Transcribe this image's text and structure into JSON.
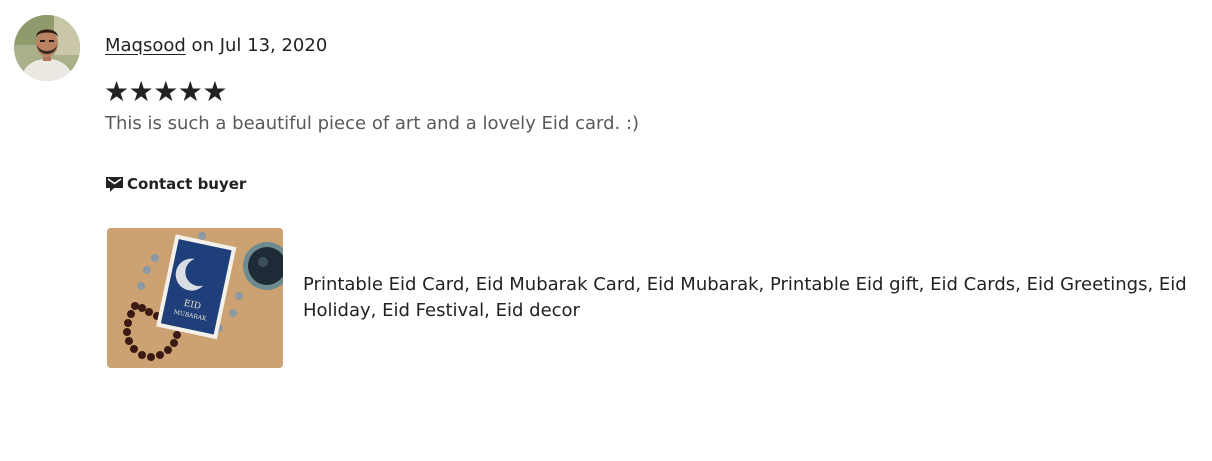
{
  "review": {
    "reviewer_name": "Maqsood",
    "date_text": " on Jul 13, 2020",
    "rating": 5,
    "stars": [
      "★",
      "★",
      "★",
      "★",
      "★"
    ],
    "text": "This is such a beautiful piece of art and a lovely Eid card. :)",
    "contact_label": "Contact buyer",
    "contact_icon": "message-icon"
  },
  "listing": {
    "title": "Printable Eid Card, Eid Mubarak Card, Eid Mubarak, Printable Eid gift, Eid Cards, Eid Greetings, Eid Holiday, Eid Festival, Eid decor",
    "card_text_line1": "EID",
    "card_text_line2": "MUBARAK"
  },
  "colors": {
    "text": "#222222",
    "muted_text": "#595959",
    "card_blue": "#1f3f7a"
  }
}
